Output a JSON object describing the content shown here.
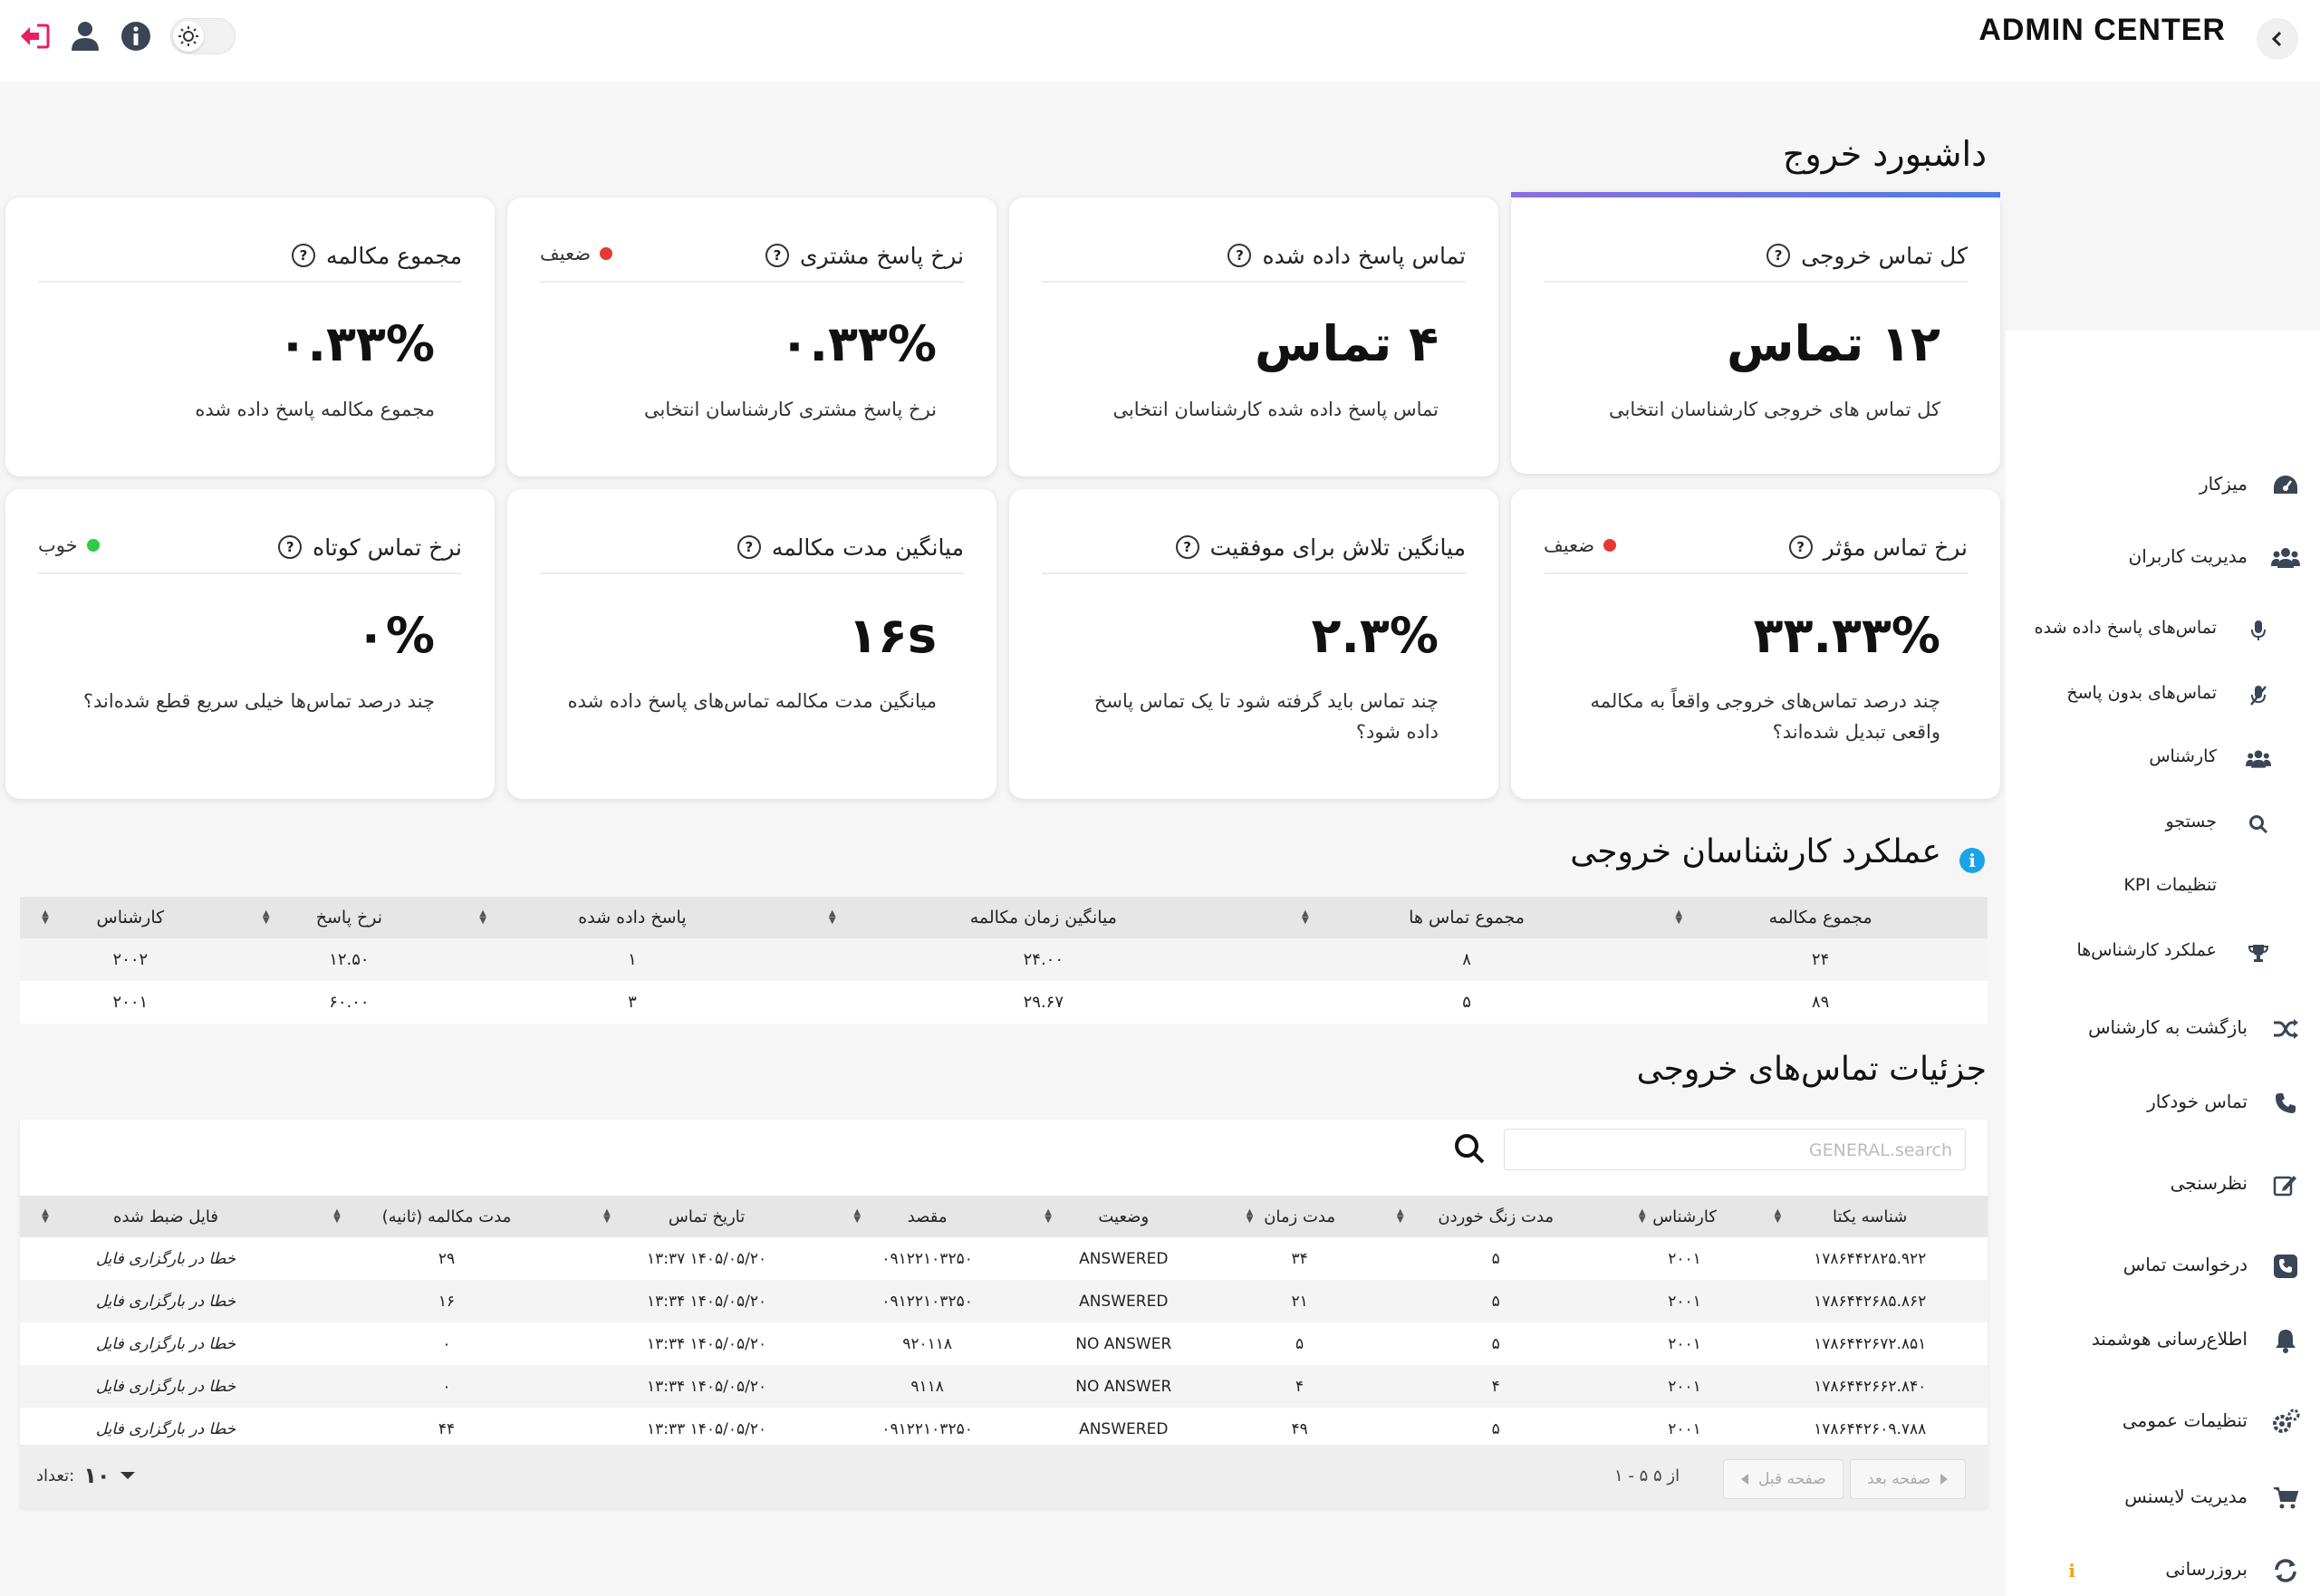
{
  "app": {
    "brand": "ADMIN CENTER"
  },
  "page": {
    "title": "داشبورد خروج"
  },
  "cards": [
    {
      "title": "کل تماس خروجی",
      "value": "۱۲ تماس",
      "desc": "کل تماس های خروجی کارشناسان انتخابی",
      "badge": "",
      "badge_color": ""
    },
    {
      "title": "تماس پاسخ داده شده",
      "value": "۴ تماس",
      "desc": "تماس پاسخ داده شده کارشناسان انتخابی",
      "badge": "",
      "badge_color": ""
    },
    {
      "title": "نرخ پاسخ مشتری",
      "value": "۰.۳۳%",
      "desc": "نرخ پاسخ مشتری کارشناسان انتخابی",
      "badge": "ضعیف",
      "badge_color": "#e53935"
    },
    {
      "title": "مجموع مکالمه",
      "value": "۰.۳۳%",
      "desc": "مجموع مکالمه پاسخ داده شده",
      "badge": "",
      "badge_color": ""
    },
    {
      "title": "نرخ تماس مؤثر",
      "value": "۳۳.۳۳%",
      "desc": "چند درصد تماس‌های خروجی واقعاً به مکالمه واقعی تبدیل شده‌اند؟",
      "badge": "ضعیف",
      "badge_color": "#e53935"
    },
    {
      "title": "میانگین تلاش برای موفقیت",
      "value": "۲.۳%",
      "desc": "چند تماس باید گرفته شود تا یک تماس پاسخ داده شود؟",
      "badge": "",
      "badge_color": ""
    },
    {
      "title": "میانگین مدت مکالمه",
      "value": "۱۶s",
      "desc": "میانگین مدت مکالمه تماس‌های پاسخ داده شده",
      "badge": "",
      "badge_color": ""
    },
    {
      "title": "نرخ تماس کوتاه",
      "value": "۰%",
      "desc": "چند درصد تماس‌ها خیلی سریع قطع شده‌اند؟",
      "badge": "خوب",
      "badge_color": "#2ecc40"
    }
  ],
  "kpi": {
    "title": "عملکرد کارشناسان خروجی",
    "columns": [
      "مجموع مکالمه",
      "مجموع تماس ها",
      "میانگین زمان مکالمه",
      "پاسخ داده شده",
      "نرخ پاسخ",
      "کارشناس"
    ],
    "rows": [
      [
        "۲۴",
        "۸",
        "۲۴.۰۰",
        "۱",
        "۱۲.۵۰",
        "۲۰۰۲"
      ],
      [
        "۸۹",
        "۵",
        "۲۹.۶۷",
        "۳",
        "۶۰.۰۰",
        "۲۰۰۱"
      ]
    ]
  },
  "calls": {
    "title": "جزئیات تماس‌های خروجی",
    "search_placeholder": "GENERAL.search",
    "columns": [
      "شناسه یکتا",
      "کارشناس",
      "مدت زنگ خوردن",
      "مدت زمان",
      "وضعیت",
      "مقصد",
      "تاریخ تماس",
      "مدت مکالمه (ثانیه)",
      "فایل ضبط شده"
    ],
    "rows": [
      [
        "۱۷۸۶۴۴۲۸۲۵.۹۲۲",
        "۲۰۰۱",
        "۵",
        "۳۴",
        "ANSWERED",
        "۰۹۱۲۲۱۰۳۲۵۰",
        "۱۴۰۵/۰۵/۲۰ ۱۳:۳۷",
        "۲۹",
        "خطا در بارگزاری فایل"
      ],
      [
        "۱۷۸۶۴۴۲۶۸۵.۸۶۲",
        "۲۰۰۱",
        "۵",
        "۲۱",
        "ANSWERED",
        "۰۹۱۲۲۱۰۳۲۵۰",
        "۱۴۰۵/۰۵/۲۰ ۱۳:۳۴",
        "۱۶",
        "خطا در بارگزاری فایل"
      ],
      [
        "۱۷۸۶۴۴۲۶۷۲.۸۵۱",
        "۲۰۰۱",
        "۵",
        "۵",
        "NO ANSWER",
        "۹۲۰۱۱۸",
        "۱۴۰۵/۰۵/۲۰ ۱۳:۳۴",
        "۰",
        "خطا در بارگزاری فایل"
      ],
      [
        "۱۷۸۶۴۴۲۶۶۲.۸۴۰",
        "۲۰۰۱",
        "۴",
        "۴",
        "NO ANSWER",
        "۹۱۱۸",
        "۱۴۰۵/۰۵/۲۰ ۱۳:۳۴",
        "۰",
        "خطا در بارگزاری فایل"
      ],
      [
        "۱۷۸۶۴۴۲۶۰۹.۷۸۸",
        "۲۰۰۱",
        "۵",
        "۴۹",
        "ANSWERED",
        "۰۹۱۲۲۱۰۳۲۵۰",
        "۱۴۰۵/۰۵/۲۰ ۱۳:۳۳",
        "۴۴",
        "خطا در بارگزاری فایل"
      ]
    ],
    "pager": {
      "next": "صفحه بعد",
      "prev": "صفحه قبل",
      "range": "از ۵ ۵ - ۱",
      "page_size": "۱۰",
      "count_label": "تعداد:"
    }
  },
  "sidebar": [
    {
      "label": "میزکار",
      "icon": "dashboard-icon",
      "sub": false
    },
    {
      "label": "مدیریت کاربران",
      "icon": "users-icon",
      "sub": false
    },
    {
      "label": "تماس‌های پاسخ داده شده",
      "icon": "microphone-icon",
      "sub": true
    },
    {
      "label": "تماس‌های بدون پاسخ",
      "icon": "microphone-off-icon",
      "sub": true
    },
    {
      "label": "کارشناس",
      "icon": "users-icon",
      "sub": true
    },
    {
      "label": "جستجو",
      "icon": "search-icon",
      "sub": true
    },
    {
      "label": "تنظیمات KPI",
      "icon": "",
      "sub": true
    },
    {
      "label": "عملکرد کارشناس‌ها",
      "icon": "trophy-icon",
      "sub": true
    },
    {
      "label": "بازگشت به کارشناس",
      "icon": "shuffle-icon",
      "sub": false
    },
    {
      "label": "تماس خودکار",
      "icon": "phone-icon",
      "sub": false
    },
    {
      "label": "نظرسنجی",
      "icon": "edit-icon",
      "sub": false
    },
    {
      "label": "درخواست تماس",
      "icon": "phone-square-icon",
      "sub": false
    },
    {
      "label": "اطلاع‌رسانی هوشمند",
      "icon": "bell-icon",
      "sub": false
    },
    {
      "label": "تنظیمات عمومی",
      "icon": "gears-icon",
      "sub": false
    },
    {
      "label": "مدیریت لایسنس",
      "icon": "cart-icon",
      "sub": false
    },
    {
      "label": "بروزرسانی",
      "icon": "sync-icon",
      "sub": false
    }
  ],
  "colors": {
    "accent": "#5b6fd8",
    "danger": "#e53935",
    "good": "#2ecc40",
    "info": "#1aa3e8",
    "logout": "#e91e63"
  }
}
